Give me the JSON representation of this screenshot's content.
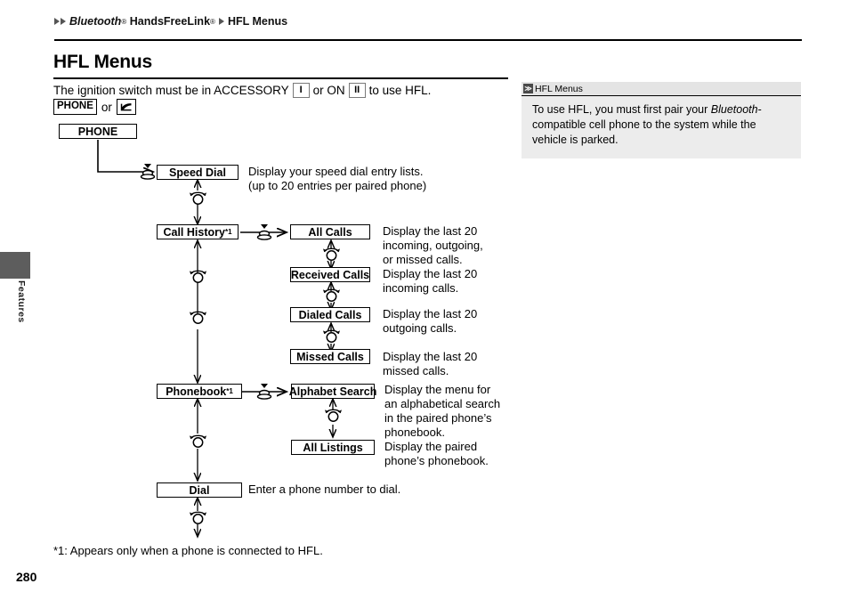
{
  "side_tab": {
    "label": "Features"
  },
  "breadcrumb": {
    "item1": "Bluetooth",
    "item1_sup": "®",
    "item2": "HandsFreeLink",
    "item2_sup": "®",
    "item3": "HFL Menus"
  },
  "page": {
    "title": "HFL Menus",
    "number": "280",
    "footnote": "*1: Appears only when a phone is connected to HFL."
  },
  "intro": {
    "text_before": "The ignition switch must be in ACCESSORY",
    "key_accessory": "I",
    "text_middle": "or ON",
    "key_on": "II",
    "text_after": "to use HFL.",
    "button_phone": "PHONE",
    "or": "or",
    "button_handset_icon": "phone-handset-icon"
  },
  "note": {
    "header_icon": "≫",
    "header_title": "HFL Menus",
    "body_before": "To use HFL, you must first pair your ",
    "body_italic": "Bluetooth",
    "body_after": "-compatible cell phone to the system while the vehicle is parked."
  },
  "flow": {
    "root": {
      "label": "PHONE"
    },
    "nodes": [
      {
        "label": "Speed Dial",
        "sup": ""
      },
      {
        "label": "Call History",
        "sup": "*1"
      },
      {
        "label": "All Calls",
        "sup": ""
      },
      {
        "label": "Received Calls",
        "sup": ""
      },
      {
        "label": "Dialed Calls",
        "sup": ""
      },
      {
        "label": "Missed Calls",
        "sup": ""
      },
      {
        "label": "Phonebook",
        "sup": "*1"
      },
      {
        "label": "Alphabet Search",
        "sup": ""
      },
      {
        "label": "All Listings",
        "sup": ""
      },
      {
        "label": "Dial",
        "sup": ""
      }
    ],
    "descriptions": [
      "Display your speed dial entry lists.\n(up to 20 entries per paired phone)",
      "Display the last 20\nincoming, outgoing,\nor missed calls.",
      "Display the last 20\nincoming calls.",
      "Display the last 20\noutgoing calls.",
      "Display the last 20\nmissed calls.",
      "Display the menu for\nan alphabetical search\nin the paired phone’s\nphonebook.",
      "Display the paired\nphone’s phonebook.",
      "Enter a phone number to dial."
    ],
    "icons": {
      "press": "knob-press-icon",
      "rotate": "knob-rotate-icon"
    }
  }
}
